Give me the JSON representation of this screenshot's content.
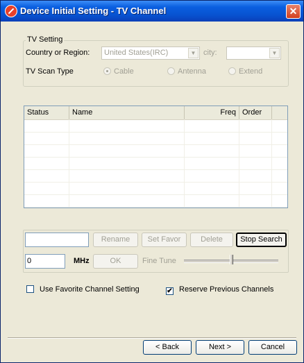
{
  "window": {
    "title": "Device Initial Setting - TV Channel",
    "close_glyph": "✕"
  },
  "tv_setting": {
    "group_label": "TV Setting",
    "country_label": "Country or Region:",
    "country_value": "United States(IRC)",
    "city_label": "city:",
    "city_value": "",
    "scan_type_label": "TV Scan Type",
    "scan_options": [
      {
        "label": "Cable",
        "selected": true
      },
      {
        "label": "Antenna",
        "selected": false
      },
      {
        "label": "Extend",
        "selected": false
      }
    ]
  },
  "channel_list": {
    "columns": [
      "Status",
      "Name",
      "Freq",
      "Order"
    ]
  },
  "editor": {
    "name_value": "",
    "rename_label": "Rename",
    "set_favor_label": "Set Favor",
    "delete_label": "Delete",
    "stop_search_label": "Stop Search",
    "freq_value": "0",
    "mhz_label": "MHz",
    "ok_label": "OK",
    "fine_tune_label": "Fine Tune"
  },
  "options": {
    "use_favorite_label": "Use Favorite Channel Setting",
    "use_favorite_checked": false,
    "reserve_previous_label": "Reserve Previous Channels",
    "reserve_previous_checked": true
  },
  "footer": {
    "back_label": "< Back",
    "next_label": "Next >",
    "cancel_label": "Cancel"
  }
}
